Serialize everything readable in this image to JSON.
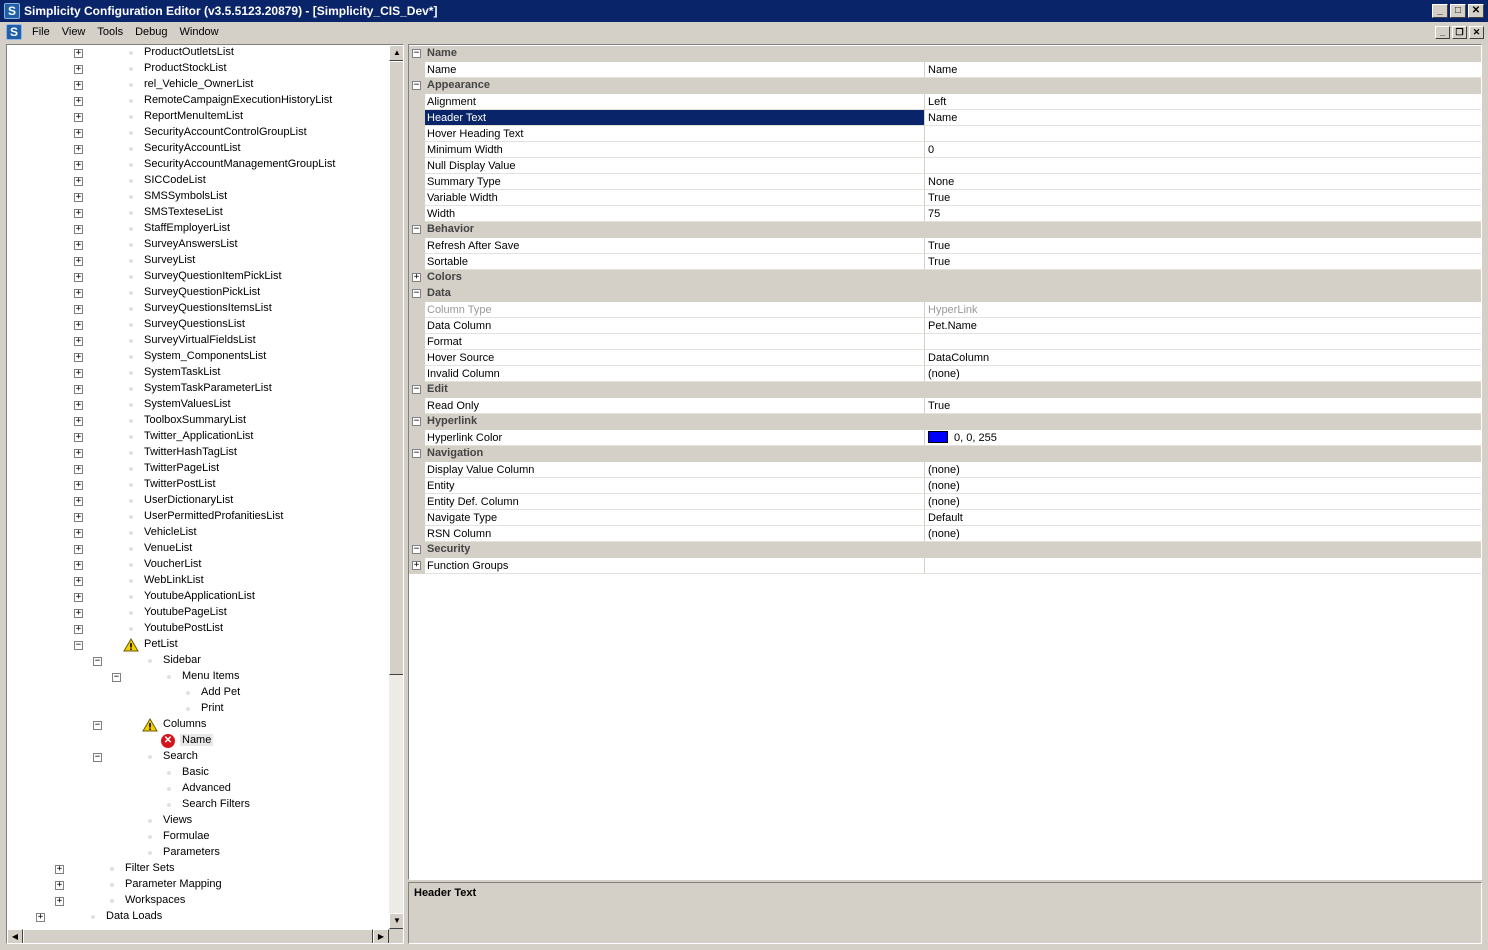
{
  "window": {
    "title": "Simplicity Configuration Editor (v3.5.5123.20879) - [Simplicity_CIS_Dev*]",
    "logo": "S"
  },
  "menu": [
    "File",
    "View",
    "Tools",
    "Debug",
    "Window"
  ],
  "tree": [
    {
      "label": "ProductOutletsList",
      "level": 3,
      "expander": "+"
    },
    {
      "label": "ProductStockList",
      "level": 3,
      "expander": "+"
    },
    {
      "label": "rel_Vehicle_OwnerList",
      "level": 3,
      "expander": "+"
    },
    {
      "label": "RemoteCampaignExecutionHistoryList",
      "level": 3,
      "expander": "+"
    },
    {
      "label": "ReportMenuItemList",
      "level": 3,
      "expander": "+"
    },
    {
      "label": "SecurityAccountControlGroupList",
      "level": 3,
      "expander": "+"
    },
    {
      "label": "SecurityAccountList",
      "level": 3,
      "expander": "+"
    },
    {
      "label": "SecurityAccountManagementGroupList",
      "level": 3,
      "expander": "+"
    },
    {
      "label": "SICCodeList",
      "level": 3,
      "expander": "+"
    },
    {
      "label": "SMSSymbolsList",
      "level": 3,
      "expander": "+"
    },
    {
      "label": "SMSTexteseList",
      "level": 3,
      "expander": "+"
    },
    {
      "label": "StaffEmployerList",
      "level": 3,
      "expander": "+"
    },
    {
      "label": "SurveyAnswersList",
      "level": 3,
      "expander": "+"
    },
    {
      "label": "SurveyList",
      "level": 3,
      "expander": "+"
    },
    {
      "label": "SurveyQuestionItemPickList",
      "level": 3,
      "expander": "+"
    },
    {
      "label": "SurveyQuestionPickList",
      "level": 3,
      "expander": "+"
    },
    {
      "label": "SurveyQuestionsItemsList",
      "level": 3,
      "expander": "+"
    },
    {
      "label": "SurveyQuestionsList",
      "level": 3,
      "expander": "+"
    },
    {
      "label": "SurveyVirtualFieldsList",
      "level": 3,
      "expander": "+"
    },
    {
      "label": "System_ComponentsList",
      "level": 3,
      "expander": "+"
    },
    {
      "label": "SystemTaskList",
      "level": 3,
      "expander": "+"
    },
    {
      "label": "SystemTaskParameterList",
      "level": 3,
      "expander": "+"
    },
    {
      "label": "SystemValuesList",
      "level": 3,
      "expander": "+"
    },
    {
      "label": "ToolboxSummaryList",
      "level": 3,
      "expander": "+"
    },
    {
      "label": "Twitter_ApplicationList",
      "level": 3,
      "expander": "+"
    },
    {
      "label": "TwitterHashTagList",
      "level": 3,
      "expander": "+"
    },
    {
      "label": "TwitterPageList",
      "level": 3,
      "expander": "+"
    },
    {
      "label": "TwitterPostList",
      "level": 3,
      "expander": "+"
    },
    {
      "label": "UserDictionaryList",
      "level": 3,
      "expander": "+"
    },
    {
      "label": "UserPermittedProfanitiesList",
      "level": 3,
      "expander": "+"
    },
    {
      "label": "VehicleList",
      "level": 3,
      "expander": "+"
    },
    {
      "label": "VenueList",
      "level": 3,
      "expander": "+"
    },
    {
      "label": "VoucherList",
      "level": 3,
      "expander": "+"
    },
    {
      "label": "WebLinkList",
      "level": 3,
      "expander": "+"
    },
    {
      "label": "YoutubeApplicationList",
      "level": 3,
      "expander": "+"
    },
    {
      "label": "YoutubePageList",
      "level": 3,
      "expander": "+"
    },
    {
      "label": "YoutubePostList",
      "level": 3,
      "expander": "+"
    },
    {
      "label": "PetList",
      "level": 3,
      "expander": "-",
      "icon": "warning"
    },
    {
      "label": "Sidebar",
      "level": 4,
      "expander": "-"
    },
    {
      "label": "Menu Items",
      "level": 5,
      "expander": "-"
    },
    {
      "label": "Add Pet",
      "level": 6,
      "expander": ""
    },
    {
      "label": "Print",
      "level": 6,
      "expander": ""
    },
    {
      "label": "Columns",
      "level": 4,
      "expander": "-",
      "icon": "warning"
    },
    {
      "label": "Name",
      "level": 5,
      "expander": "",
      "icon": "error",
      "selected": true
    },
    {
      "label": "Search",
      "level": 4,
      "expander": "-"
    },
    {
      "label": "Basic",
      "level": 5,
      "expander": ""
    },
    {
      "label": "Advanced",
      "level": 5,
      "expander": ""
    },
    {
      "label": "Search Filters",
      "level": 5,
      "expander": ""
    },
    {
      "label": "Views",
      "level": 4,
      "expander": ""
    },
    {
      "label": "Formulae",
      "level": 4,
      "expander": ""
    },
    {
      "label": "Parameters",
      "level": 4,
      "expander": ""
    },
    {
      "label": "Filter Sets",
      "level": 2,
      "expander": "+"
    },
    {
      "label": "Parameter Mapping",
      "level": 2,
      "expander": "+"
    },
    {
      "label": "Workspaces",
      "level": 2,
      "expander": "+"
    },
    {
      "label": "Data Loads",
      "level": 1,
      "expander": "+"
    }
  ],
  "properties": [
    {
      "type": "category",
      "label": "Name",
      "expander": "-"
    },
    {
      "type": "prop",
      "name": "Name",
      "value": "Name"
    },
    {
      "type": "category",
      "label": "Appearance",
      "expander": "-"
    },
    {
      "type": "prop",
      "name": "Alignment",
      "value": "Left"
    },
    {
      "type": "prop",
      "name": "Header Text",
      "value": "Name",
      "selected": true
    },
    {
      "type": "prop",
      "name": "Hover Heading Text",
      "value": ""
    },
    {
      "type": "prop",
      "name": "Minimum Width",
      "value": "0"
    },
    {
      "type": "prop",
      "name": "Null Display Value",
      "value": ""
    },
    {
      "type": "prop",
      "name": "Summary Type",
      "value": "None"
    },
    {
      "type": "prop",
      "name": "Variable Width",
      "value": "True"
    },
    {
      "type": "prop",
      "name": "Width",
      "value": "75"
    },
    {
      "type": "category",
      "label": "Behavior",
      "expander": "-"
    },
    {
      "type": "prop",
      "name": "Refresh After Save",
      "value": "True"
    },
    {
      "type": "prop",
      "name": "Sortable",
      "value": "True"
    },
    {
      "type": "category",
      "label": "Colors",
      "expander": "+"
    },
    {
      "type": "category",
      "label": "Data",
      "expander": "-"
    },
    {
      "type": "prop",
      "name": "Column Type",
      "value": "HyperLink",
      "disabled": true
    },
    {
      "type": "prop",
      "name": "Data Column",
      "value": "Pet.Name"
    },
    {
      "type": "prop",
      "name": "Format",
      "value": ""
    },
    {
      "type": "prop",
      "name": "Hover Source",
      "value": "DataColumn"
    },
    {
      "type": "prop",
      "name": "Invalid Column",
      "value": "(none)"
    },
    {
      "type": "category",
      "label": "Edit",
      "expander": "-"
    },
    {
      "type": "prop",
      "name": "Read Only",
      "value": "True"
    },
    {
      "type": "category",
      "label": "Hyperlink",
      "expander": "-"
    },
    {
      "type": "prop",
      "name": "Hyperlink Color",
      "value": "0, 0, 255",
      "swatch": "#0000ff"
    },
    {
      "type": "category",
      "label": "Navigation",
      "expander": "-"
    },
    {
      "type": "prop",
      "name": "Display Value Column",
      "value": "(none)"
    },
    {
      "type": "prop",
      "name": "Entity",
      "value": "(none)"
    },
    {
      "type": "prop",
      "name": "Entity Def. Column",
      "value": "(none)"
    },
    {
      "type": "prop",
      "name": "Navigate Type",
      "value": "Default"
    },
    {
      "type": "prop",
      "name": "RSN Column",
      "value": "(none)"
    },
    {
      "type": "category",
      "label": "Security",
      "expander": "-"
    },
    {
      "type": "prop",
      "name": "Function Groups",
      "value": "",
      "expander": "+"
    }
  ],
  "description": {
    "title": "Header Text"
  },
  "colors": {
    "titlebar": "#0a246a",
    "selection": "#0a246a",
    "chrome": "#d4d0c8"
  }
}
